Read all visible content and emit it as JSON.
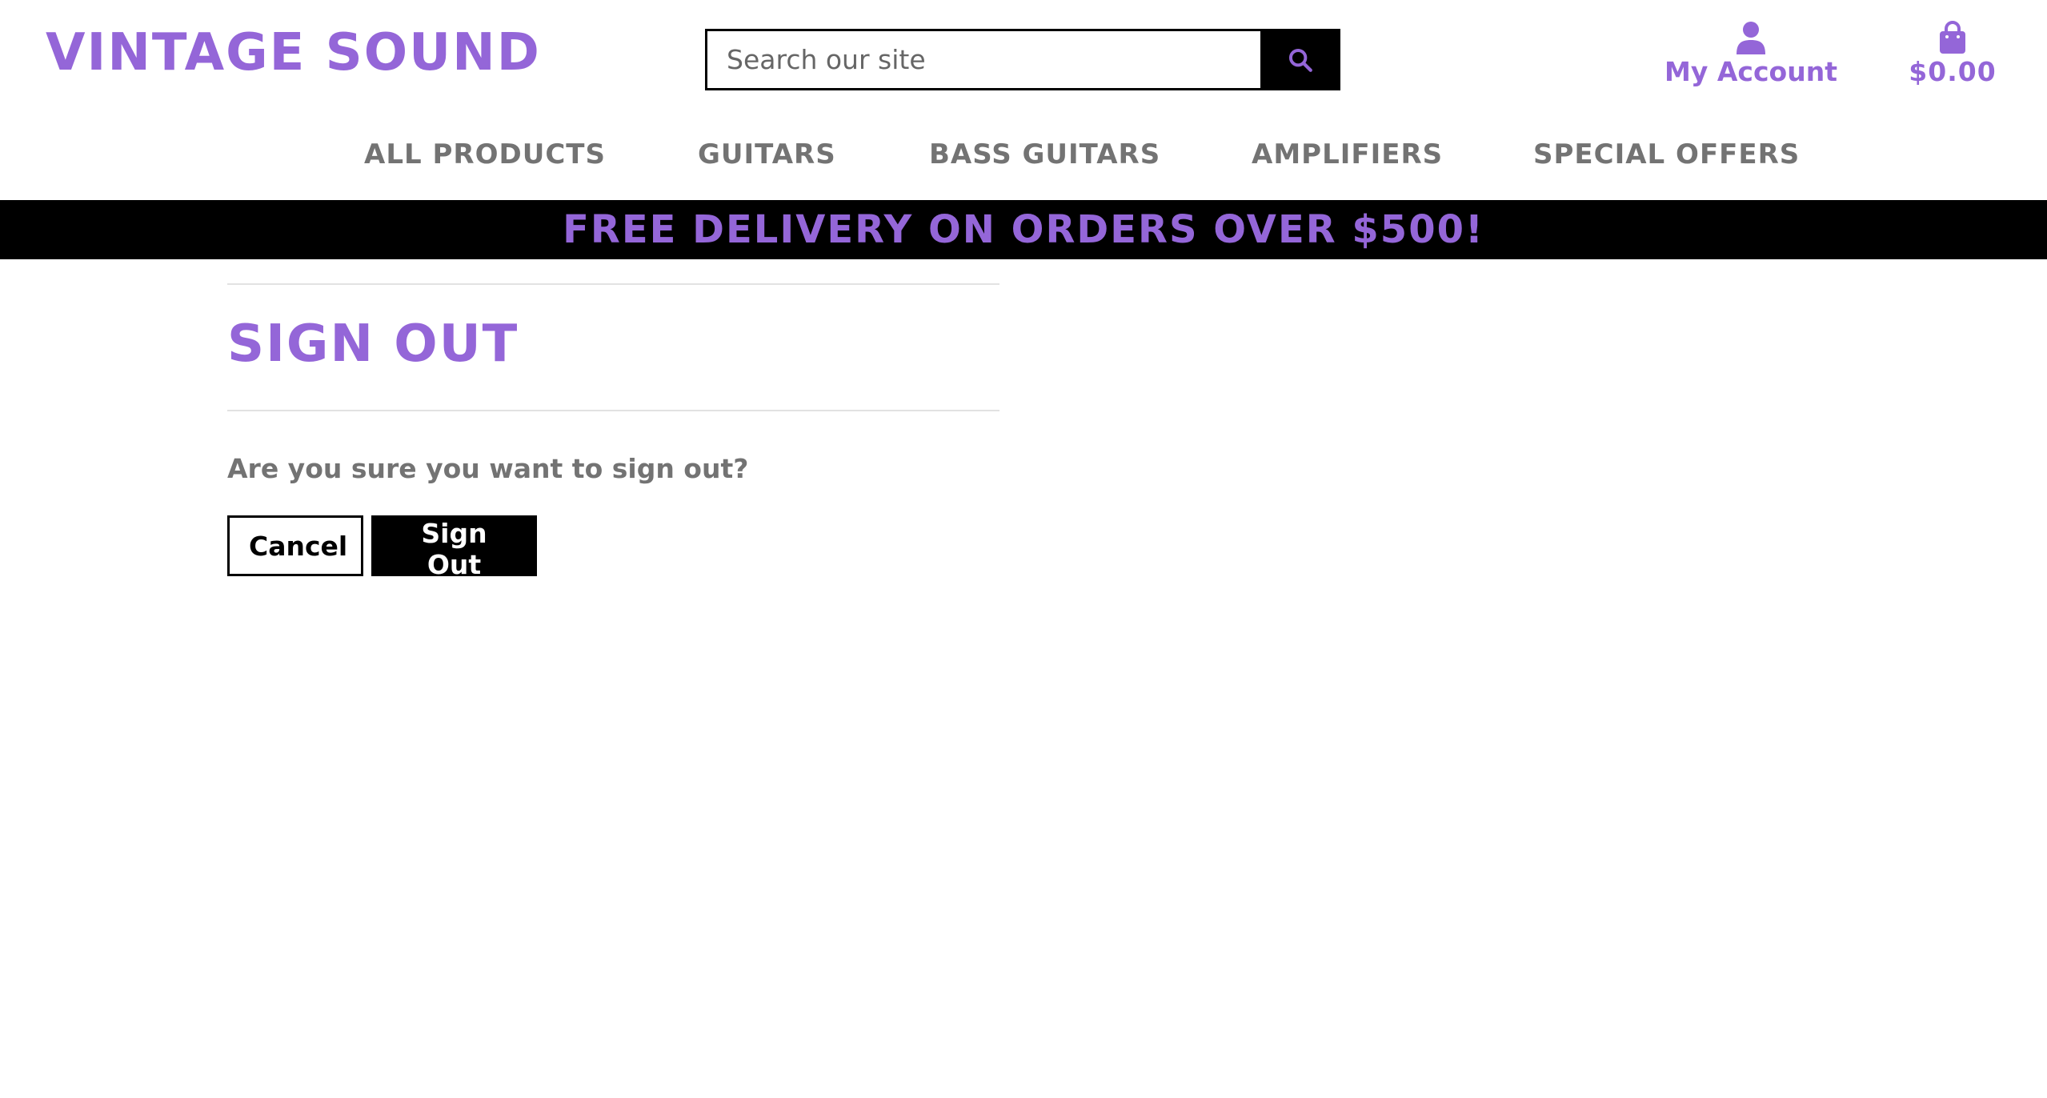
{
  "header": {
    "logo": "VINTAGE SOUND",
    "search": {
      "placeholder": "Search our site",
      "value": ""
    },
    "account": {
      "label": "My Account",
      "icon": "user-icon"
    },
    "cart": {
      "label": "$0.00",
      "icon": "shopping-bag-icon"
    }
  },
  "nav": {
    "items": [
      {
        "label": "ALL PRODUCTS"
      },
      {
        "label": "GUITARS"
      },
      {
        "label": "BASS GUITARS"
      },
      {
        "label": "AMPLIFIERS"
      },
      {
        "label": "SPECIAL OFFERS"
      }
    ]
  },
  "banner": {
    "text": "FREE DELIVERY ON ORDERS OVER $500!"
  },
  "main": {
    "title": "SIGN OUT",
    "question": "Are you sure you want to sign out?",
    "cancel_label": "Cancel",
    "signout_label": "Sign Out"
  },
  "colors": {
    "brand": "#9466d8",
    "nav_text": "#737373",
    "banner_bg": "#000000"
  }
}
